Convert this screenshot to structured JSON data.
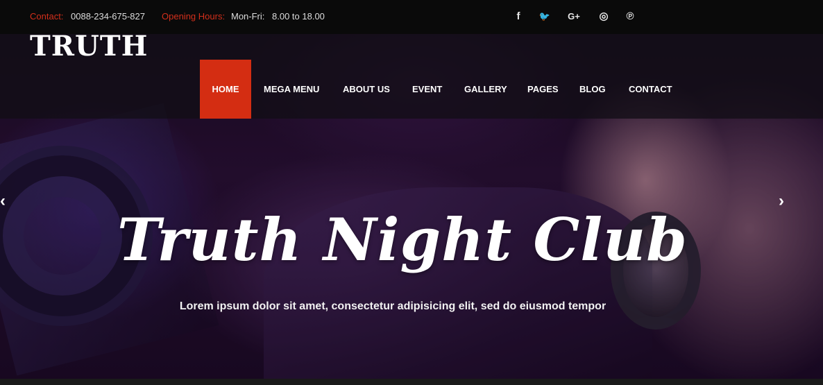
{
  "topbar": {
    "contact_label": "Contact:",
    "contact_value": "0088-234-675-827",
    "hours_label": "Opening Hours:",
    "hours_days": "Mon-Fri:",
    "hours_value": "8.00 to 18.00",
    "social": [
      {
        "icon": "facebook-icon",
        "glyph": "f"
      },
      {
        "icon": "twitter-icon",
        "glyph": "🐦"
      },
      {
        "icon": "google-plus-icon",
        "glyph": "G+"
      },
      {
        "icon": "instagram-icon",
        "glyph": "◎"
      },
      {
        "icon": "pinterest-icon",
        "glyph": "℗"
      }
    ]
  },
  "header": {
    "logo": "TRUTH",
    "nav": [
      {
        "label": "HOME",
        "active": true
      },
      {
        "label": "MEGA MENU",
        "active": false
      },
      {
        "label": "ABOUT US",
        "active": false
      },
      {
        "label": "EVENT",
        "active": false
      },
      {
        "label": "GALLERY",
        "active": false
      },
      {
        "label": "PAGES",
        "active": false
      },
      {
        "label": "BLOG",
        "active": false
      },
      {
        "label": "CONTACT",
        "active": false
      }
    ]
  },
  "slider": {
    "title": "Truth Night Club",
    "subtitle": "Lorem ipsum dolor sit amet, consectetur adipisicing elit, sed do eiusmod tempor",
    "prev_glyph": "‹",
    "next_glyph": "›"
  },
  "colors": {
    "accent": "#d42d12",
    "label_red": "#d32f1b",
    "topbar_bg": "#0a0a0a"
  }
}
